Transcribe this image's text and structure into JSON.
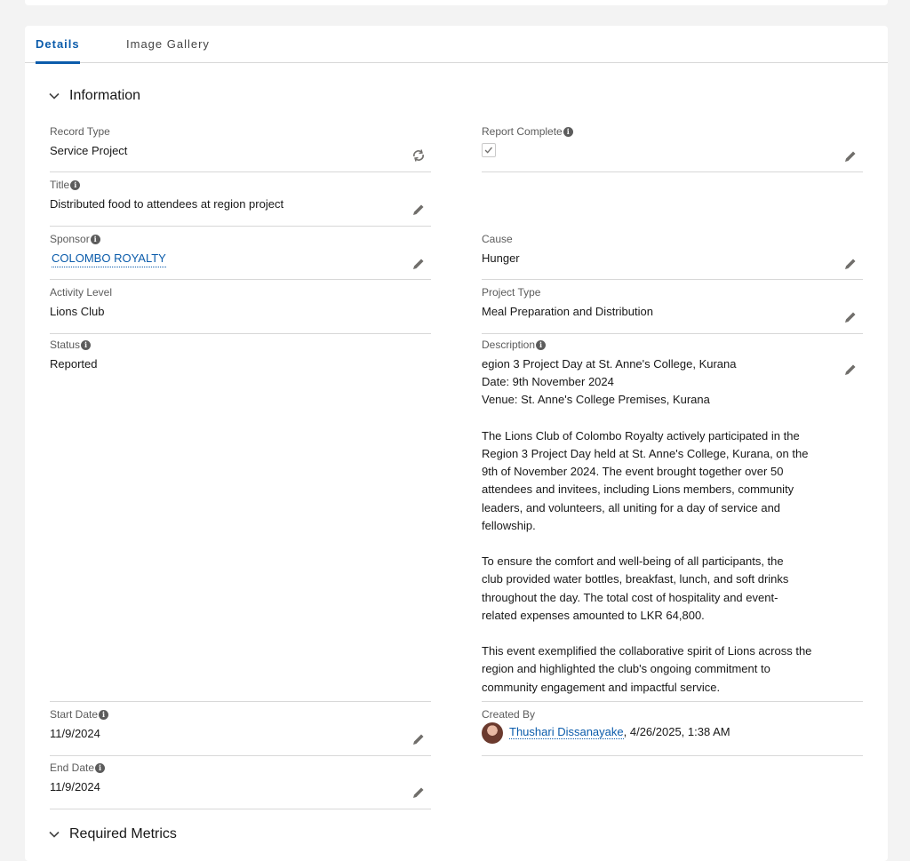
{
  "tabs": [
    {
      "label": "Details",
      "active": true
    },
    {
      "label": "Image Gallery",
      "active": false
    }
  ],
  "sections": {
    "information": "Information",
    "required_metrics": "Required Metrics"
  },
  "fields": {
    "record_type": {
      "label": "Record Type",
      "value": "Service Project"
    },
    "report_complete": {
      "label": "Report Complete",
      "checked": true
    },
    "title": {
      "label": "Title",
      "value": "Distributed food to attendees at region project"
    },
    "sponsor": {
      "label": "Sponsor",
      "value": "COLOMBO ROYALTY"
    },
    "cause": {
      "label": "Cause",
      "value": "Hunger"
    },
    "activity_level": {
      "label": "Activity Level",
      "value": "Lions Club"
    },
    "project_type": {
      "label": "Project Type",
      "value": "Meal Preparation and Distribution"
    },
    "status": {
      "label": "Status",
      "value": "Reported"
    },
    "description": {
      "label": "Description",
      "paragraphs": [
        "egion 3 Project Day at St. Anne's College, Kurana\nDate: 9th November 2024\nVenue: St. Anne's College Premises, Kurana",
        "The Lions Club of Colombo Royalty actively participated in the\nRegion 3 Project Day held at St. Anne's College, Kurana, on the\n9th of November 2024. The event brought together over 50\nattendees and invitees, including Lions members, community\nleaders, and volunteers, all uniting for a day of service and\nfellowship.",
        "To ensure the comfort and well-being of all participants, the\nclub provided water bottles, breakfast, lunch, and soft drinks\nthroughout the day. The total cost of hospitality and event-\nrelated expenses amounted to LKR 64,800.",
        "This event exemplified the collaborative spirit of Lions across the\nregion and highlighted the club's ongoing commitment to\ncommunity engagement and impactful service."
      ]
    },
    "start_date": {
      "label": "Start Date",
      "value": "11/9/2024"
    },
    "end_date": {
      "label": "End Date",
      "value": "11/9/2024"
    },
    "created_by": {
      "label": "Created By",
      "user": "Thushari Dissanayake",
      "timestamp": ", 4/26/2025, 1:38 AM"
    }
  },
  "icons": {
    "edit": "pencil-icon",
    "info": "info-icon",
    "chevron": "chevron-down-icon",
    "record_type_change": "change-record-type-icon"
  },
  "colors": {
    "link": "#0b5cab",
    "active_tab": "#0b5cab",
    "divider": "#d8d8d8",
    "label": "#5c5c5c"
  }
}
